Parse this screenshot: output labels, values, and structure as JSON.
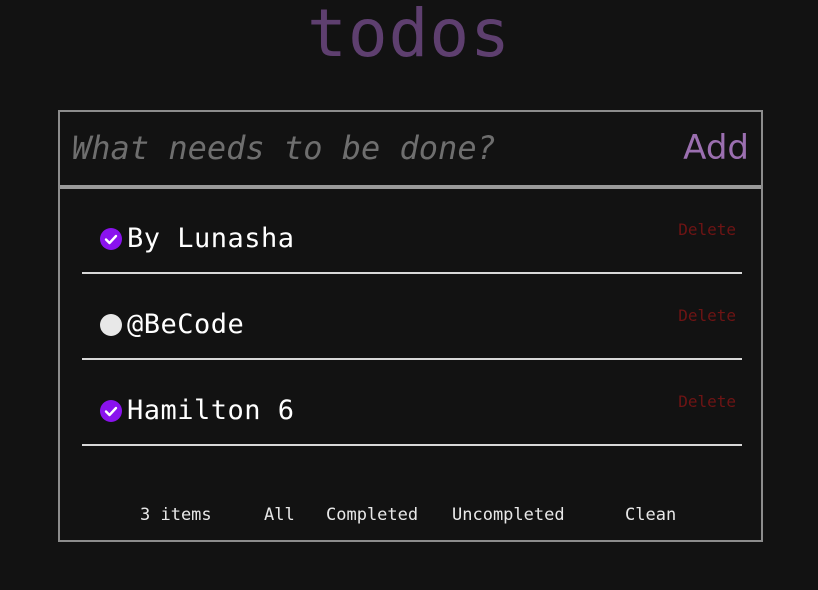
{
  "app": {
    "title": "todos"
  },
  "input": {
    "placeholder": "What needs to be done?",
    "value": "",
    "add_label": "Add"
  },
  "todos": [
    {
      "text": "By Lunasha",
      "completed": true,
      "delete_label": "Delete"
    },
    {
      "text": "@BeCode",
      "completed": false,
      "delete_label": "Delete"
    },
    {
      "text": "Hamilton 6",
      "completed": true,
      "delete_label": "Delete"
    }
  ],
  "footer": {
    "count_label": "3 items",
    "filter_all": "All",
    "filter_completed": "Completed",
    "filter_uncompleted": "Uncompleted",
    "clean_label": "Clean"
  },
  "colors": {
    "background": "#121212",
    "title": "#5e3f6f",
    "accent_purple": "#8a12ee",
    "add_button": "#9b6fb0",
    "delete_red": "#6e1414",
    "border": "#8c8c8c"
  },
  "icons": {
    "completed": "check-circle-icon",
    "uncompleted": "empty-circle-icon"
  }
}
